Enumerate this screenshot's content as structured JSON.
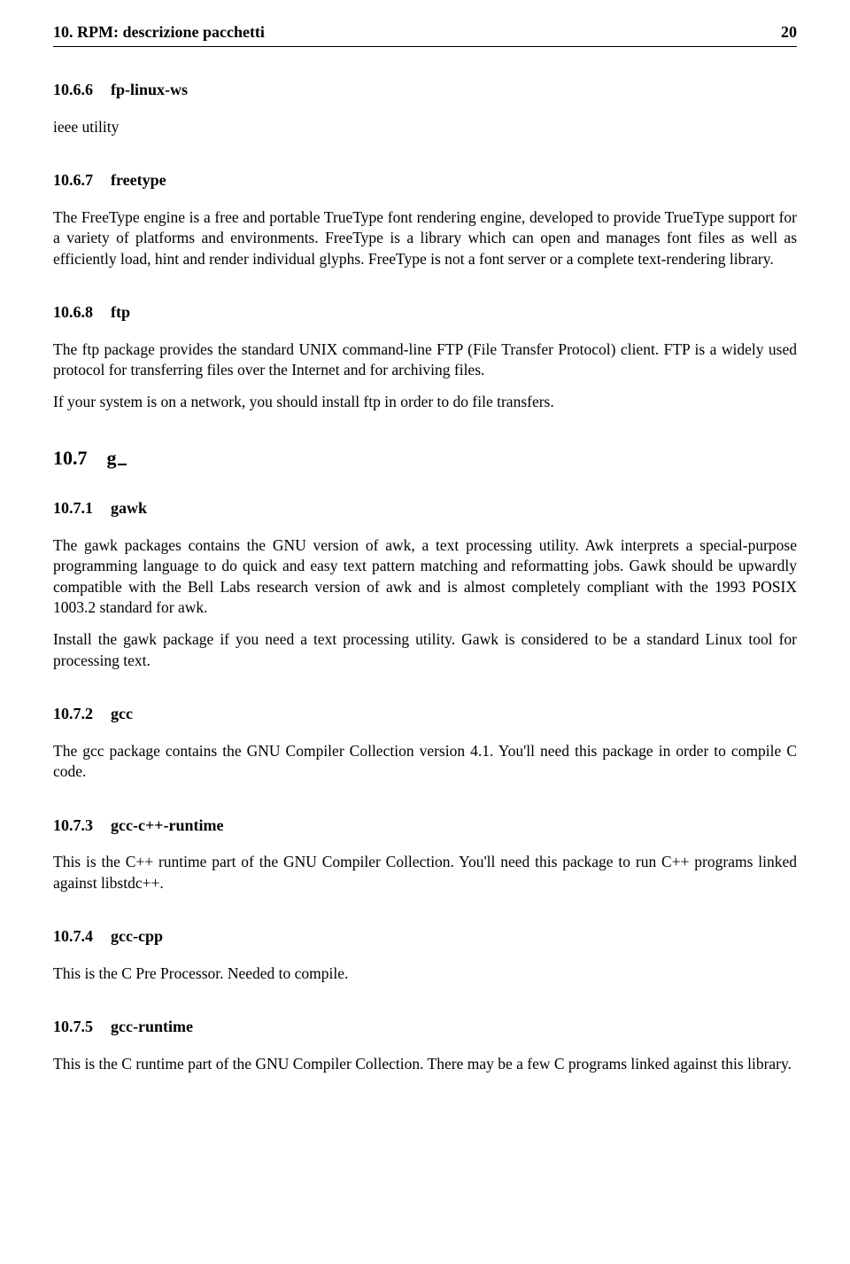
{
  "header": {
    "left": "10.   RPM: descrizione pacchetti",
    "right": "20"
  },
  "sections": {
    "s1": {
      "num": "10.6.6",
      "title": "fp-linux-ws",
      "para1": "ieee utility"
    },
    "s2": {
      "num": "10.6.7",
      "title": "freetype",
      "para1": "The FreeType engine is a free and portable TrueType font rendering engine, developed to provide TrueType support for a variety of platforms and environments. FreeType is a library which can open and manages font files as well as efficiently load, hint and render individual glyphs. FreeType is not a font server or a complete text-rendering library."
    },
    "s3": {
      "num": "10.6.8",
      "title": "ftp",
      "para1": "The ftp package provides the standard UNIX command-line FTP (File Transfer Protocol) client. FTP is a widely used protocol for transferring files over the Internet and for archiving files.",
      "para2": "If your system is on a network, you should install ftp in order to do file transfers."
    },
    "s4": {
      "num": "10.7",
      "title": "g"
    },
    "s5": {
      "num": "10.7.1",
      "title": "gawk",
      "para1": "The gawk packages contains the GNU version of awk, a text processing utility. Awk interprets a special-purpose programming language to do quick and easy text pattern matching and reformatting jobs. Gawk should be upwardly compatible with the Bell Labs research version of awk and is almost completely compliant with the 1993 POSIX 1003.2 standard for awk.",
      "para2": "Install the gawk package if you need a text processing utility. Gawk is considered to be a standard Linux tool for processing text."
    },
    "s6": {
      "num": "10.7.2",
      "title": "gcc",
      "para1": "The gcc package contains the GNU Compiler Collection version 4.1. You'll need this package in order to compile C code."
    },
    "s7": {
      "num": "10.7.3",
      "title": "gcc-c++-runtime",
      "para1": "This is the C++ runtime part of the GNU Compiler Collection. You'll need this package to run C++ programs linked against libstdc++."
    },
    "s8": {
      "num": "10.7.4",
      "title": "gcc-cpp",
      "para1": "This is the C Pre Processor. Needed to compile."
    },
    "s9": {
      "num": "10.7.5",
      "title": "gcc-runtime",
      "para1": "This is the C runtime part of the GNU Compiler Collection. There may be a few C programs linked against this library."
    }
  }
}
